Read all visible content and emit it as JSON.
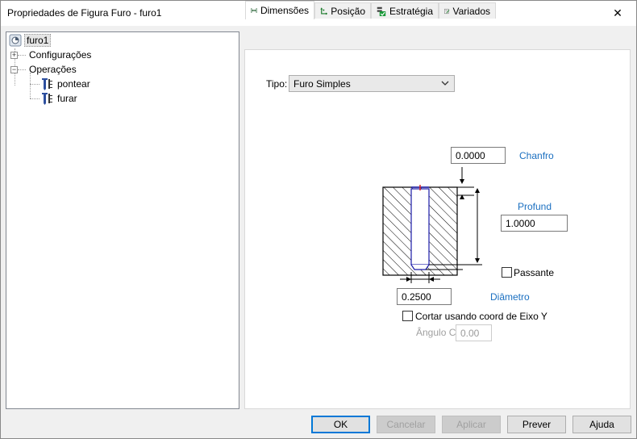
{
  "window": {
    "title": "Propriedades de Figura Furo - furo1",
    "close_glyph": "✕"
  },
  "tree": {
    "root": {
      "label": "furo1",
      "icon": "hole-feature-icon"
    },
    "items": [
      {
        "label": "Configurações",
        "expander": "+"
      },
      {
        "label": "Operações",
        "expander": "−"
      }
    ],
    "operations": [
      {
        "label": "pontear",
        "icon": "spot-drill-icon"
      },
      {
        "label": "furar",
        "icon": "drill-icon"
      }
    ]
  },
  "tabs": [
    {
      "label": "Dimensões",
      "icon": "dimensions-icon",
      "active": true
    },
    {
      "label": "Posição",
      "icon": "position-icon",
      "active": false
    },
    {
      "label": "Estratégia",
      "icon": "strategy-icon",
      "active": false
    },
    {
      "label": "Variados",
      "icon": "misc-icon",
      "active": false
    }
  ],
  "dimensions": {
    "tipo_label": "Tipo:",
    "tipo_value": "Furo Simples",
    "chanfro_label": "Chanfro",
    "chanfro_value": "0.0000",
    "profund_label": "Profund",
    "profund_value": "1.0000",
    "passante_label": "Passante",
    "passante_checked": false,
    "diametro_label": "Diâmetro",
    "diametro_value": "0.2500",
    "cortar_label": "Cortar usando coord de Eixo Y",
    "cortar_checked": false,
    "angulo_label": "Ângulo C",
    "angulo_value": "0.00"
  },
  "buttons": {
    "ok": "OK",
    "cancelar": "Cancelar",
    "aplicar": "Aplicar",
    "prever": "Prever",
    "ajuda": "Ajuda"
  },
  "colors": {
    "link_blue": "#1a6fc0",
    "hole_outline": "#1a1aa8",
    "focus_blue": "#0078d7"
  }
}
